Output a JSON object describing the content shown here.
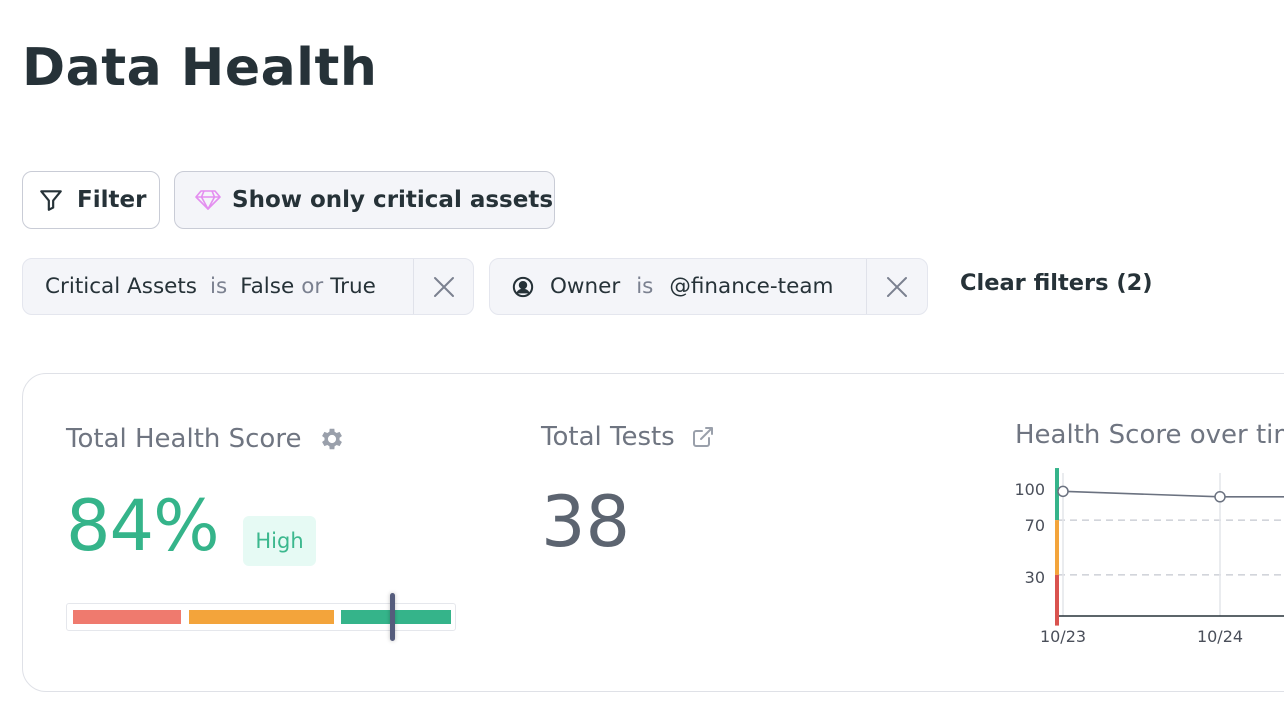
{
  "page": {
    "title": "Data Health"
  },
  "toolbar": {
    "filter_label": "Filter",
    "critical_label": "Show only critical assets"
  },
  "filters": [
    {
      "field": "Critical Assets",
      "operator": "is",
      "value1": "False",
      "joiner": "or",
      "value2": "True"
    },
    {
      "icon": "user-circle-icon",
      "field": "Owner",
      "operator": "is",
      "value": "@finance-team"
    }
  ],
  "clear_filters_label": "Clear filters (2)",
  "score_card": {
    "label": "Total Health Score",
    "value": "84%",
    "badge": "High",
    "score_fraction": 0.84,
    "colors": {
      "low": "#ef7a6e",
      "medium": "#f3a43b",
      "high": "#35b48a"
    }
  },
  "tests_card": {
    "label": "Total Tests",
    "value": "38"
  },
  "chart_card": {
    "label": "Health Score over time"
  },
  "chart_data": {
    "type": "line",
    "title": "Health Score over time",
    "x": [
      "10/23",
      "10/24"
    ],
    "values": [
      91,
      87
    ],
    "y_ticks": [
      "100",
      "70",
      "30"
    ],
    "ylim": [
      0,
      100
    ],
    "thresholds": [
      70,
      30
    ],
    "colors": {
      "line": "#6b7280",
      "high": "#35b48a",
      "medium": "#f3a43b",
      "low": "#d9534f"
    }
  }
}
